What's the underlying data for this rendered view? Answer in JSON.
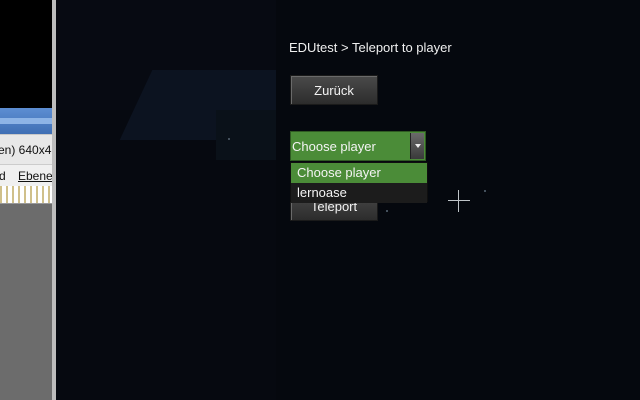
{
  "background_window": {
    "toolbar_text": "en) 640x4",
    "menu_items": [
      "d",
      "Ebene"
    ]
  },
  "dialog": {
    "breadcrumb": "EDUtest > Teleport to player",
    "back_button": "Zurück",
    "teleport_button": "Teleport",
    "player_dropdown": {
      "selected": "Choose player",
      "options": [
        "Choose player",
        "lernoase"
      ]
    }
  },
  "colors": {
    "accent_green": "#4b8c38",
    "button_bg": "#3a3a3a"
  }
}
